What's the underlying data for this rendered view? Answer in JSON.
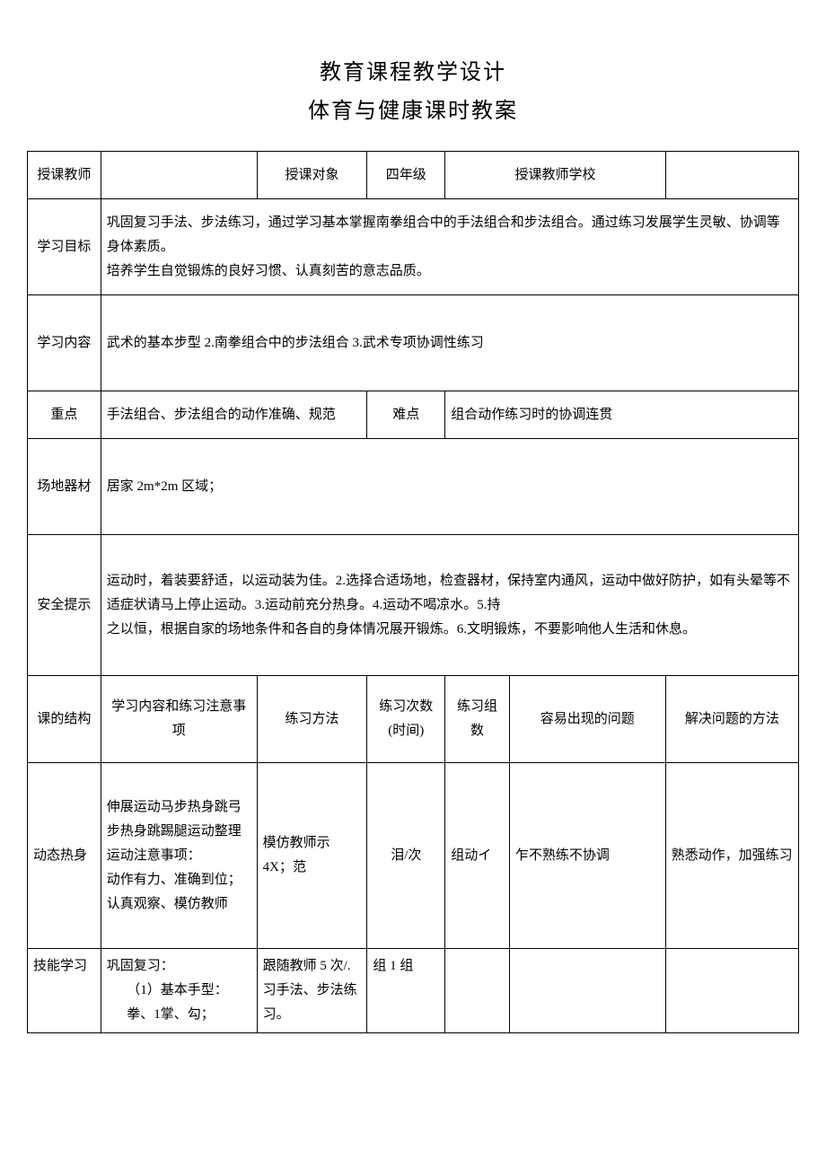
{
  "titles": {
    "main": "教育课程教学设计",
    "sub": "体育与健康课时教案"
  },
  "header": {
    "teacher_label": "授课教师",
    "teacher_value": "",
    "audience_label": "授课对象",
    "audience_value": "四年级",
    "school_label": "授课教师学校",
    "school_value": ""
  },
  "goals": {
    "label": "学习目标",
    "line1": "巩固复习手法、步法练习，通过学习基本掌握南拳组合中的手法组合和步法组合。通过练习发展学生灵敏、协调等身体素质。",
    "line2": "培养学生自觉锻炼的良好习惯、认真刻苦的意志品质。"
  },
  "content": {
    "label": "学习内容",
    "text": "武术的基本步型 2.南拳组合中的步法组合 3.武术专项协调性练习"
  },
  "focus": {
    "key_label": "重点",
    "key_text": "手法组合、步法组合的动作准确、规范",
    "diff_label": "难点",
    "diff_text": "组合动作练习时的协调连贯"
  },
  "venue": {
    "label": "场地器材",
    "text": "居家 2m*2m 区域；"
  },
  "safety": {
    "label": "安全提示",
    "line1": "运动时，着装要舒适，以运动装为佳。2.选择合适场地，检查器材，保持室内通风，运动中做好防护，如有头晕等不适症状请马上停止运动。3.运动前充分热身。4.运动不喝凉水。5.持",
    "line2": "之以恒，根据自家的场地条件和各自的身体情况展开锻炼。6.文明锻炼，不要影响他人生活和休息。"
  },
  "table_header": {
    "col1": "课的结构",
    "col2": "学习内容和练习注意事项",
    "col3": "练习方法",
    "col4": "练习次数(时间)",
    "col5": "练习组数",
    "col6": "容易出现的问题",
    "col7": "解决问题的方法"
  },
  "warmup": {
    "col1": "动态热身",
    "col2": "伸展运动马步热身跳弓步热身跳踢腿运动整理运动注意事项：\n动作有力、准确到位；认真观察、模仿教师",
    "col3": "模仿教师示 4X；范",
    "col4": "泪/次",
    "col5": "组动イ",
    "col6": "乍不熟练不协调",
    "col7": "熟悉动作，加强练习"
  },
  "skill": {
    "col1": "技能学习",
    "col2_a": "巩固复习：",
    "col2_b": "（1）基本手型：拳、1掌、勾；",
    "col3": "跟随教师 5 次/.习手法、步法练习。",
    "col4": "组 1 组",
    "col5": "",
    "col6": "",
    "col7": ""
  }
}
